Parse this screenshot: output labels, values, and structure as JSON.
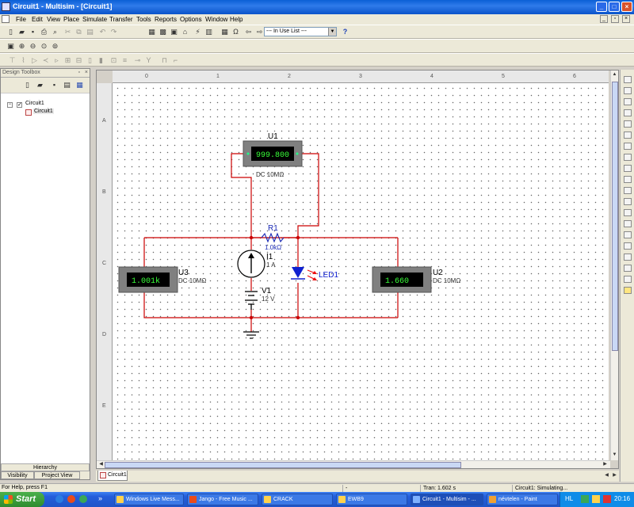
{
  "window": {
    "title": "Circuit1 - Multisim - [Circuit1]"
  },
  "menu": [
    "File",
    "Edit",
    "View",
    "Place",
    "Simulate",
    "Transfer",
    "Tools",
    "Reports",
    "Options",
    "Window",
    "Help"
  ],
  "toolbar": {
    "in_use_list": "--- In Use List ---"
  },
  "toolbox": {
    "title": "Design Toolbox",
    "tree": {
      "root": "Circuit1",
      "child": "Circuit1"
    },
    "hierarchy_label": "Hierarchy",
    "tabs": [
      "Visibility",
      "Project View"
    ]
  },
  "ruler": {
    "columns": [
      "0",
      "1",
      "2",
      "3",
      "4",
      "5",
      "6"
    ],
    "rows": [
      "A",
      "B",
      "C",
      "D",
      "E"
    ]
  },
  "schematic": {
    "u1": {
      "ref": "U1",
      "reading": "999.800",
      "mode": "DC  10MΩ"
    },
    "u2": {
      "ref": "U2",
      "reading": "1.660",
      "mode": "DC  10MΩ"
    },
    "u3": {
      "ref": "U3",
      "reading": "1.001k",
      "mode": "DC  10MΩ"
    },
    "r1": {
      "ref": "R1",
      "value": "1.0kΩ"
    },
    "i1": {
      "ref": "I1",
      "value": "1 A"
    },
    "v1": {
      "ref": "V1",
      "value": "12 V"
    },
    "led1": {
      "ref": "LED1"
    },
    "colors": {
      "wire": "#cc0000",
      "led": "#1020d0",
      "meter_text": "#39ff39"
    }
  },
  "sheet_tab": "Circuit1",
  "status": {
    "help": "For Help, press F1",
    "dash": "-",
    "tran": "Tran: 1.602 s",
    "sim": "Circuit1: Simulating..."
  },
  "taskbar": {
    "start": "Start",
    "tasks": [
      "Windows Live Mess...",
      "Jango - Free Music ...",
      "CRACK",
      "EWB9",
      "Circuit1 - Multisim - ...",
      "névtelen - Paint"
    ],
    "lang": "HL",
    "clock": "20:16"
  }
}
